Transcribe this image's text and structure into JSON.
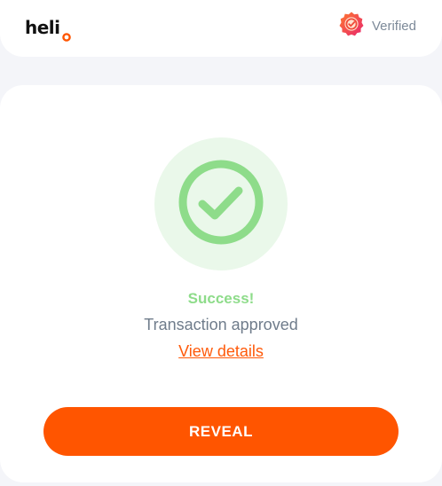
{
  "header": {
    "logo_text": "heli",
    "verified_label": "Verified"
  },
  "status": {
    "title": "Success!",
    "subtitle": "Transaction approved",
    "details_link": "View details"
  },
  "actions": {
    "reveal_label": "REVEAL"
  },
  "colors": {
    "accent": "#ff5500",
    "success": "#8edc8a",
    "success_bg": "#eaf8ea",
    "muted_text": "#6f7c8b",
    "page_bg": "#f4f5f9"
  }
}
